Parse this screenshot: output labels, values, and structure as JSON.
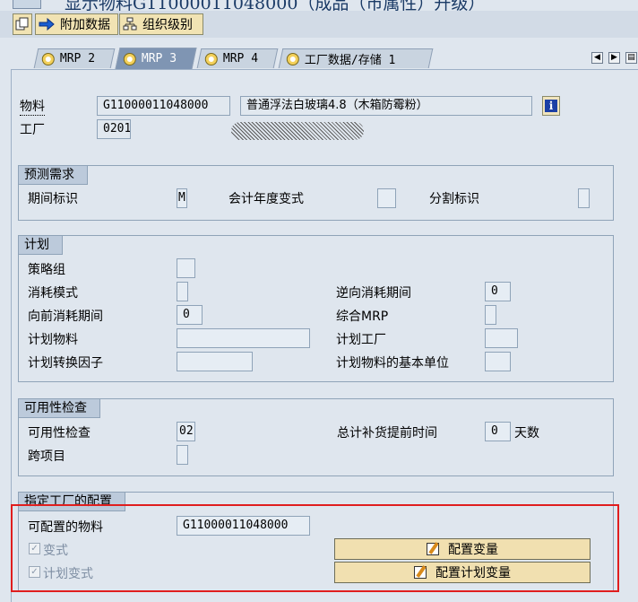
{
  "window": {
    "title": "显示物料G11000011048000（成品（市属性）升级）"
  },
  "toolbar": {
    "additional_data_label": "附加数据",
    "org_levels_label": "组织级别"
  },
  "tabs": [
    {
      "label": "MRP 2",
      "active": false
    },
    {
      "label": "MRP 3",
      "active": true
    },
    {
      "label": "MRP 4",
      "active": false
    },
    {
      "label": "工厂数据/存储 1",
      "active": false
    }
  ],
  "header": {
    "material_label": "物料",
    "material_value": "G11000011048000",
    "material_desc": "普通浮法白玻璃4.8（木箱防霉粉）",
    "plant_label": "工厂",
    "plant_value": "0201"
  },
  "forecast": {
    "title": "预测需求",
    "period_indicator_label": "期间标识",
    "period_indicator_value": "M",
    "fiscal_year_variant_label": "会计年度变式",
    "fiscal_year_variant_value": "",
    "splitting_indicator_label": "分割标识",
    "splitting_indicator_value": ""
  },
  "planning": {
    "title": "计划",
    "strategy_group_label": "策略组",
    "consumption_mode_label": "消耗模式",
    "bwd_consumption_label": "逆向消耗期间",
    "bwd_consumption_value": "0",
    "fwd_consumption_label": "向前消耗期间",
    "fwd_consumption_value": "0",
    "mixed_mrp_label": "综合MRP",
    "planning_material_label": "计划物料",
    "planning_plant_label": "计划工厂",
    "conv_factor_label": "计划转换因子",
    "base_unit_label": "计划物料的基本单位"
  },
  "availability": {
    "title": "可用性检查",
    "check_label": "可用性检查",
    "check_value": "02",
    "total_rlt_label": "总计补货提前时间",
    "total_rlt_value": "0",
    "days_label": "天数",
    "cross_project_label": "跨项目"
  },
  "config": {
    "title": "指定工厂的配置",
    "configurable_material_label": "可配置的物料",
    "configurable_material_value": "G11000011048000",
    "variant_label": "变式",
    "variant_checked": true,
    "planning_variant_label": "计划变式",
    "planning_variant_checked": true,
    "config_variant_button": "配置变量",
    "config_planning_variant_button": "配置计划变量"
  },
  "icons": {
    "tab_icon": "circle-icon",
    "info": "info-icon",
    "edit": "edit-icon",
    "arrow": "arrow-right-icon",
    "org": "org-levels-icon"
  },
  "colors": {
    "highlight_frame": "#e01e1e",
    "active_tab": "#7f95b3",
    "button_fill": "#f1e0b0"
  }
}
